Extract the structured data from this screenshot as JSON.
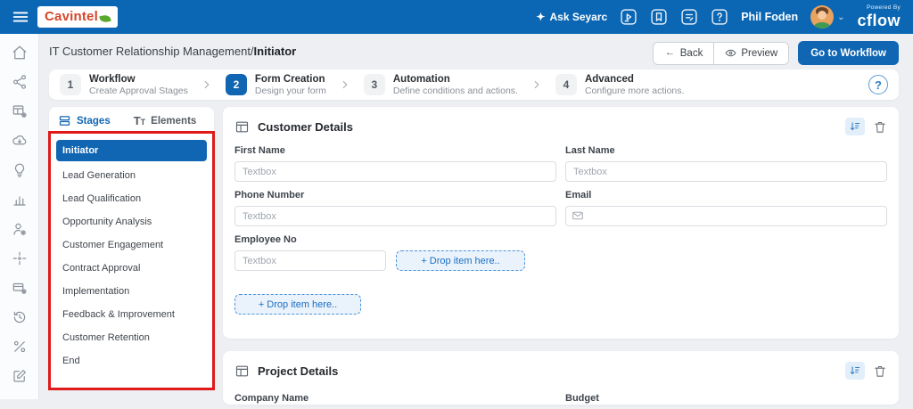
{
  "topbar": {
    "brand": "Cavintel",
    "ask_label": "Ask Seyarc",
    "sparkle": "✦",
    "user_name": "Phil Foden",
    "powered_by_label": "Powered By",
    "powered_by_brand": "cflow",
    "chevron": "⌄"
  },
  "breadcrumb": {
    "path": "IT Customer Relationship Management/",
    "current": "Initiator"
  },
  "page_actions": {
    "back_label": "Back",
    "back_arrow": "←",
    "preview_label": "Preview",
    "go_to_workflow_label": "Go to Workflow"
  },
  "stepper": {
    "help_label": "?",
    "steps": [
      {
        "number": "1",
        "title": "Workflow",
        "subtitle": "Create Approval Stages"
      },
      {
        "number": "2",
        "title": "Form Creation",
        "subtitle": "Design your form"
      },
      {
        "number": "3",
        "title": "Automation",
        "subtitle": "Define conditions and actions."
      },
      {
        "number": "4",
        "title": "Advanced",
        "subtitle": "Configure more actions."
      }
    ]
  },
  "sidebar": {
    "tabs": [
      {
        "label": "Stages"
      },
      {
        "label": "Elements"
      }
    ],
    "elements_icon_big": "T",
    "elements_icon_small": "T",
    "selected_stage": "Initiator",
    "stages": [
      "Initiator",
      "Lead Generation",
      "Lead Qualification",
      "Opportunity Analysis",
      "Customer Engagement",
      "Contract Approval",
      "Implementation",
      "Feedback & Improvement",
      "Customer Retention",
      "End"
    ]
  },
  "sections": {
    "customer_details": {
      "title": "Customer Details",
      "fields": {
        "first_name": {
          "label": "First Name",
          "placeholder": "Textbox"
        },
        "last_name": {
          "label": "Last Name",
          "placeholder": "Textbox"
        },
        "phone_number": {
          "label": "Phone Number",
          "placeholder": "Textbox"
        },
        "email": {
          "label": "Email"
        },
        "employee_no": {
          "label": "Employee No",
          "placeholder": "Textbox"
        }
      },
      "drop_zone_label": "+ Drop item here.."
    },
    "project_details": {
      "title": "Project Details",
      "fields": {
        "company_name": {
          "label": "Company Name"
        },
        "budget": {
          "label": "Budget"
        }
      }
    }
  },
  "colors": {
    "header_blue": "#0b67b4",
    "accent_blue": "#1166b3",
    "annotation_red": "#e01a1a",
    "dropzone_blue": "#1b6ec2"
  }
}
